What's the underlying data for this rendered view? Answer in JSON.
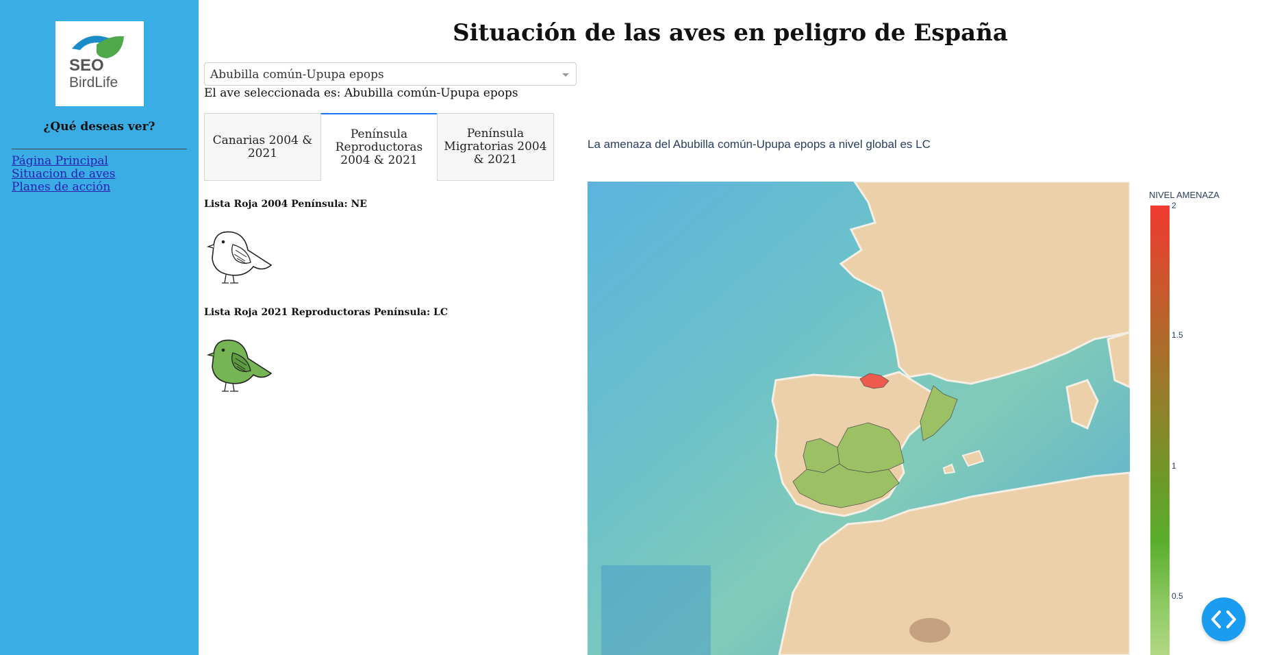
{
  "sidebar": {
    "logo": {
      "line1": "SEO",
      "line2": "BirdLife"
    },
    "question": "¿Qué deseas ver?",
    "nav": [
      {
        "label": "Página Principal"
      },
      {
        "label": "Situacion de aves"
      },
      {
        "label": "Planes de acción"
      }
    ]
  },
  "header": {
    "title": "Situación de las aves en peligro de España"
  },
  "bird_select": {
    "value": "Abubilla común-Upupa epops"
  },
  "selected_bird_text": "El ave seleccionada es: Abubilla común-Upupa epops",
  "tabs": [
    {
      "label": "Canarias 2004 & 2021",
      "active": false
    },
    {
      "label": "Península Reproductoras 2004 & 2021",
      "active": true
    },
    {
      "label": "Península Migratorias 2004 & 2021",
      "active": false
    }
  ],
  "red_list": {
    "label_2004": "Lista Roja 2004 Península: NE",
    "label_2021": "Lista Roja 2021 Reproductoras Península: LC"
  },
  "threat_text": "La amenaza del Abubilla común-Upupa epops a nivel global es LC",
  "colorbar": {
    "title": "NIVEL AMENAZA",
    "ticks": [
      "2",
      "1.5",
      "1",
      "0.5"
    ]
  },
  "colors": {
    "sidebar": "#3aade4",
    "link": "#2a1fb0",
    "tab_active_border": "#1975fa",
    "threat_high": "#f03a30",
    "threat_low": "#8cc860"
  },
  "icons": {
    "fab": "code-brackets-icon",
    "bird_2004": "bird-outline-icon",
    "bird_2021": "bird-green-icon"
  }
}
